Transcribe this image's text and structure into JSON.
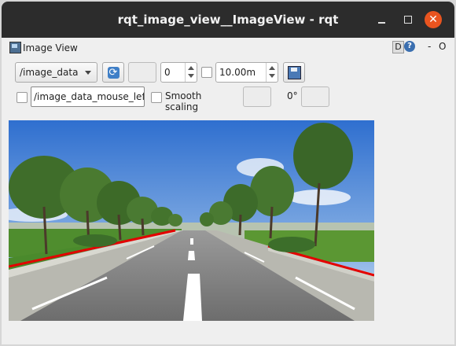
{
  "window": {
    "title": "rqt_image_view__ImageView - rqt",
    "minimize_icon": "minimize-icon",
    "maximize_icon": "maximize-icon",
    "close_icon": "close-icon",
    "close_color": "#e9541f"
  },
  "plugin": {
    "title": "Image View",
    "d_label": "D",
    "help_label": "?",
    "dash_label": "-",
    "close_label": "O"
  },
  "toolbar": {
    "topic_selected": "/image_data",
    "spin_value": "0",
    "rate_value": "10.00m",
    "refresh_icon": "refresh-icon",
    "save_icon": "save-icon"
  },
  "row2": {
    "mouse_topic": "/image_data_mouse_left",
    "smooth_scaling_label": "Smooth scaling",
    "rotation_label": "0°",
    "smooth_scaling_checked": false
  },
  "image": {
    "description_key": "road-scene",
    "lane_line_color": "#e30000"
  }
}
